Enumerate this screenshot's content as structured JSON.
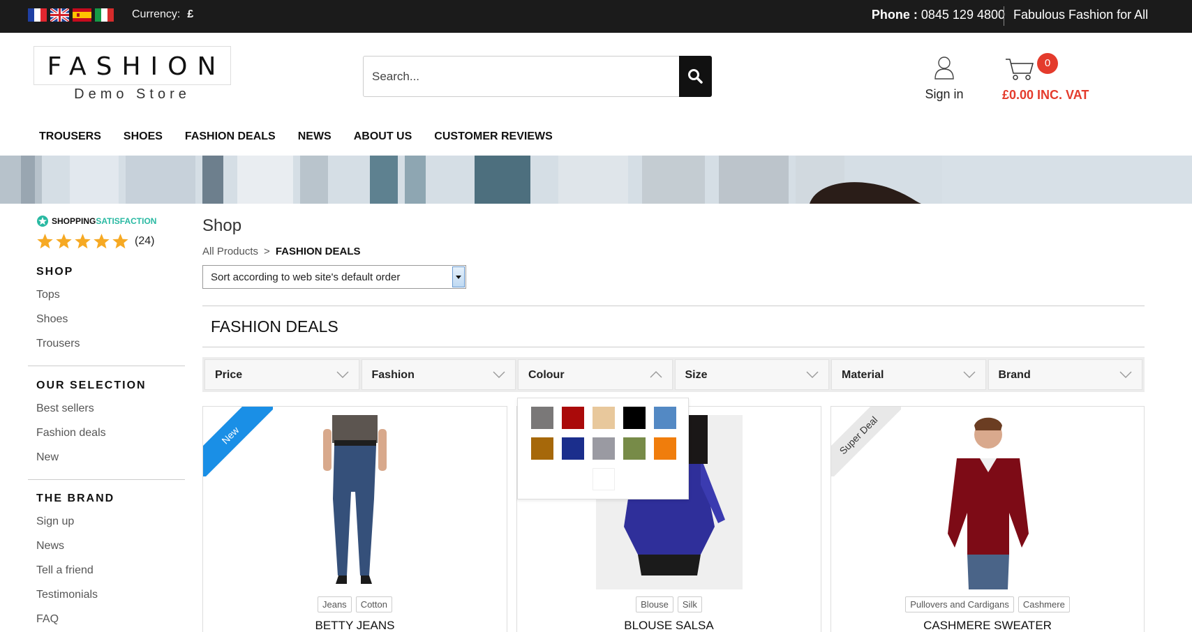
{
  "topbar": {
    "currency_label": "Currency:",
    "currency_symbol": "£",
    "phone_label": "Phone :",
    "phone_number": "0845 129 4800",
    "tagline": "Fabulous Fashion for All",
    "flags": [
      "france-flag-icon",
      "uk-flag-icon",
      "spain-flag-icon",
      "italy-flag-icon"
    ]
  },
  "header": {
    "logo_main": "FASHION",
    "logo_sub": "Demo Store",
    "search_placeholder": "Search...",
    "signin_label": "Sign in",
    "cart_count": "0",
    "cart_total": "£0.00 INC. VAT"
  },
  "nav": [
    "TROUSERS",
    "SHOES",
    "FASHION DEALS",
    "NEWS",
    "ABOUT US",
    "CUSTOMER REVIEWS"
  ],
  "sidebar": {
    "satisfaction_a": "SHOPPING",
    "satisfaction_b": "SATISFACTION",
    "rating_count": "(24)",
    "shop_heading": "SHOP",
    "shop_items": [
      "Tops",
      "Shoes",
      "Trousers"
    ],
    "selection_heading": "OUR SELECTION",
    "selection_items": [
      "Best sellers",
      "Fashion deals",
      "New"
    ],
    "brand_heading": "THE BRAND",
    "brand_items": [
      "Sign up",
      "News",
      "Tell a friend",
      "Testimonials",
      "FAQ"
    ]
  },
  "main": {
    "page_title": "Shop",
    "breadcrumb_root": "All Products",
    "breadcrumb_sep": ">",
    "breadcrumb_current": "FASHION DEALS",
    "sort_value": "Sort according to web site's default order",
    "section_title": "FASHION DEALS",
    "filters": [
      "Price",
      "Fashion",
      "Colour",
      "Size",
      "Material",
      "Brand"
    ]
  },
  "colour_swatches": [
    "#7a7878",
    "#aa0a0a",
    "#e8c89c",
    "#000000",
    "#5389c4",
    "#a6680a",
    "#1b2e8c",
    "#9a9aa2",
    "#778b48",
    "#f07d0c",
    "#ffffff"
  ],
  "products": [
    {
      "name": "BETTY JEANS",
      "ribbon": "New",
      "tags": [
        "Jeans",
        "Cotton"
      ]
    },
    {
      "name": "BLOUSE SALSA",
      "ribbon": "",
      "tags": [
        "Blouse",
        "Silk"
      ]
    },
    {
      "name": "CASHMERE SWEATER",
      "ribbon": "Super Deal",
      "tags": [
        "Pullovers and Cardigans",
        "Cashmere"
      ]
    }
  ]
}
